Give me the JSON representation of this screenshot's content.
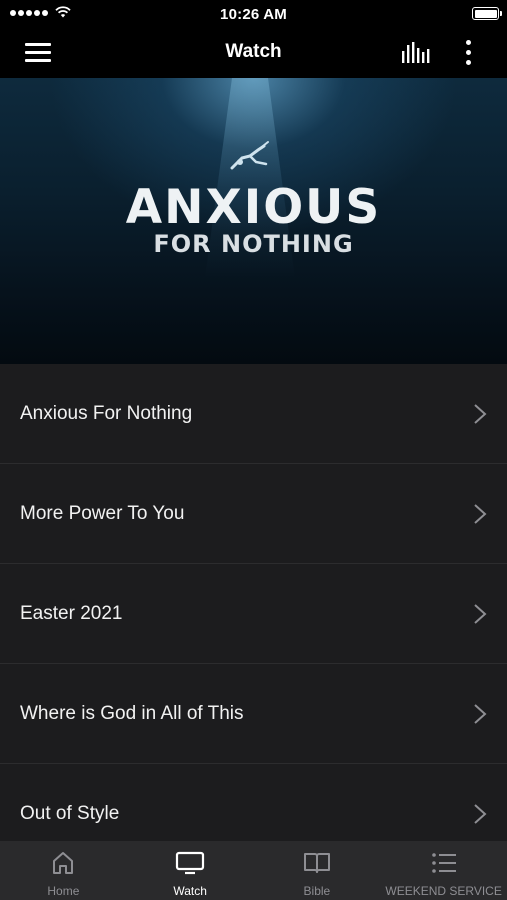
{
  "status_bar": {
    "time": "10:26 AM"
  },
  "nav": {
    "title": "Watch",
    "icons": [
      "menu-icon",
      "equalizer-icon",
      "more-vertical-icon"
    ]
  },
  "hero": {
    "title_main": "ANXIOUS",
    "title_sub": "FOR NOTHING"
  },
  "list": {
    "items": [
      {
        "label": "Anxious For Nothing"
      },
      {
        "label": "More Power To You"
      },
      {
        "label": "Easter 2021"
      },
      {
        "label": "Where is God in All of This"
      },
      {
        "label": "Out of Style"
      }
    ]
  },
  "tabs": {
    "items": [
      {
        "label": "Home",
        "icon": "home-icon",
        "active": false
      },
      {
        "label": "Watch",
        "icon": "tv-icon",
        "active": true
      },
      {
        "label": "Bible",
        "icon": "book-icon",
        "active": false
      },
      {
        "label": "WEEKEND SERVICE",
        "icon": "list-icon",
        "active": false
      }
    ]
  },
  "colors": {
    "background": "#000000",
    "list_background": "#1c1c1e",
    "tab_bar_background": "#2a2a2c",
    "inactive_tab": "#8e8e93",
    "active_tab": "#ffffff"
  }
}
